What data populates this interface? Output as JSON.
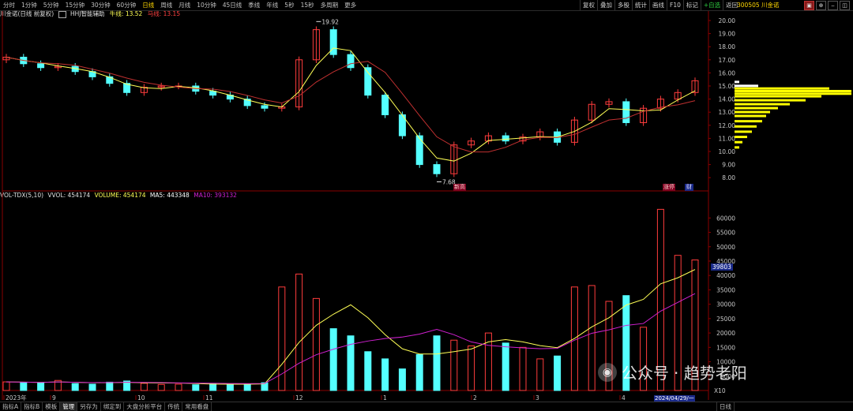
{
  "toolbar": {
    "periods": [
      "分时",
      "1分钟",
      "5分钟",
      "15分钟",
      "30分钟",
      "60分钟",
      "日线",
      "周线",
      "月线",
      "10分钟",
      "45日线",
      "季线",
      "年线",
      "5秒",
      "15秒",
      "多周期",
      "更多"
    ],
    "active_period": "日线",
    "buttons": [
      "复权",
      "叠加",
      "多股",
      "统计",
      "画线",
      "F10",
      "标记",
      "+自选",
      "返回"
    ],
    "stock_title": "300505 川金诺"
  },
  "info": {
    "name": "川金诺(日线 前复权)",
    "indicator": "HHJ智能辅助",
    "ox_label": "牛线: 13.52",
    "horse_label": "马线: 13.15"
  },
  "volume_info": {
    "name": "VOL-TDX(5,10)",
    "vvol": "VVOL: 454174",
    "volume": "VOLUME: 454174",
    "ma5": "MA5: 443348",
    "ma10": "MA10: 393132"
  },
  "price_axis": [
    "20.00",
    "19.00",
    "18.00",
    "17.00",
    "16.00",
    "15.00",
    "14.00",
    "13.00",
    "12.00",
    "11.00",
    "10.00",
    "9.00",
    "8.00"
  ],
  "volume_axis": [
    "60000",
    "55000",
    "50000",
    "45000",
    "40000",
    "35000",
    "30000",
    "25000",
    "20000",
    "15000",
    "10000",
    "5000"
  ],
  "volume_axis_unit": "X10",
  "current_volume_label": "39803",
  "date_labels": [
    "2023年",
    "9",
    "10",
    "11",
    "12",
    "1",
    "2",
    "3",
    "4"
  ],
  "date_cursor": "2024/04/29/一",
  "annotations": {
    "high": "19.92",
    "low": "7.68",
    "tag1": "新高",
    "tag2": "涨停",
    "tag3": "财"
  },
  "bottom_tabs": [
    "指标A",
    "指标B",
    "模板",
    "管理",
    "另存为",
    "绑定到",
    "大盘分析平台",
    "传统",
    "常用看盘"
  ],
  "bottom_right": "日线",
  "watermark": {
    "channel": "公众号",
    "author": "· 趋势老阳"
  },
  "colors": {
    "up": "#ff3c3c",
    "down": "#54ffff",
    "ma5": "#ffff55",
    "ma10": "#d020d0",
    "grid": "#8a0000",
    "axis_text": "#c8c8c8"
  },
  "chart_data": [
    {
      "type": "candlestick",
      "title": "川金诺(日线 前复权)",
      "y_range": [
        7.5,
        20.5
      ],
      "x": [
        "2023年",
        "9",
        "10",
        "11",
        "12",
        "1",
        "2",
        "3",
        "4"
      ],
      "close_approx": [
        17.2,
        16.7,
        16.4,
        16.5,
        16.1,
        15.7,
        15.2,
        14.5,
        14.9,
        15.0,
        15.0,
        14.6,
        14.3,
        14.0,
        13.5,
        13.3,
        13.4,
        17.0,
        19.3,
        17.4,
        16.4,
        14.3,
        12.8,
        11.2,
        9.0,
        8.3,
        10.5,
        10.8,
        11.2,
        10.8,
        11.1,
        11.5,
        10.7,
        12.4,
        13.6,
        13.8,
        12.2,
        13.3,
        14.0,
        14.5,
        15.4
      ],
      "ma_lines": [
        "牛线",
        "马线"
      ],
      "ma_last": {
        "牛线": 13.52,
        "马线": 13.15
      }
    },
    {
      "type": "bar",
      "title": "VOL-TDX(5,10)",
      "y_range": [
        0,
        62000
      ],
      "values": [
        3000,
        2800,
        2600,
        3500,
        2400,
        2200,
        2900,
        3300,
        2500,
        2100,
        2200,
        2000,
        2400,
        2300,
        2100,
        2700,
        36000,
        40500,
        32000,
        21500,
        19000,
        13500,
        11000,
        7500,
        12500,
        19000,
        17500,
        15500,
        20000,
        16500,
        15000,
        11000,
        12000,
        36000,
        36500,
        31000,
        33000,
        22000,
        63000,
        47000,
        45400
      ],
      "ma_values": {
        "MA5": 443348,
        "MA10": 393132
      }
    }
  ]
}
